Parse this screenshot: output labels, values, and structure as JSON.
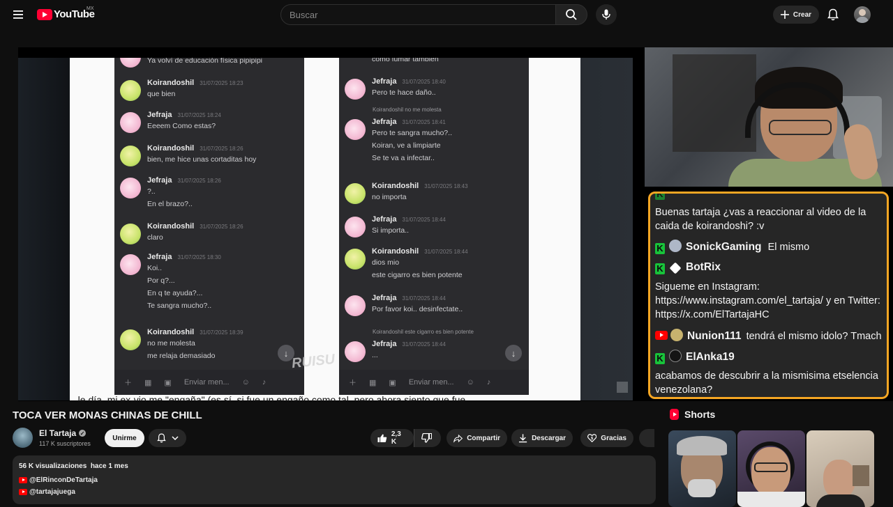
{
  "header": {
    "logo_text": "YouTube",
    "region": "MX",
    "search_placeholder": "Buscar",
    "create_label": "Crear"
  },
  "video": {
    "title": "TOCA VER MONAS CHINAS DE CHILL",
    "channel_name": "El Tartaja",
    "subscribers": "117 K suscriptores",
    "join_label": "Unirme",
    "like_count": "2,3 K",
    "share_label": "Compartir",
    "download_label": "Descargar",
    "thanks_label": "Gracias",
    "stats": "56 K visualizaciones  hace 1 mes",
    "links": [
      "@ElRinconDeTartaja",
      "@tartajajuega"
    ]
  },
  "screen": {
    "top_line_left": "Ya volví de educación física pipipipi",
    "top_line_right": "como fumar también",
    "input_placeholder": "Enviar men...",
    "watermark": "RUISU",
    "caption_fragment": "...le día, mi ex-vio me \"engaña\" (es sí, si fue un engaño como tal, pero ahora siento que fue...",
    "left_messages": [
      {
        "name": "Koirandoshil",
        "time": "31/07/2025 18:23",
        "lines": [
          "que bien"
        ],
        "avatar": "k"
      },
      {
        "name": "Jefraja",
        "time": "31/07/2025 18:24",
        "lines": [
          "Eeeem Como estas?"
        ],
        "avatar": "j"
      },
      {
        "name": "Koirandoshil",
        "time": "31/07/2025 18:26",
        "lines": [
          "bien, me hice unas cortaditas hoy"
        ],
        "avatar": "k"
      },
      {
        "name": "Jefraja",
        "time": "31/07/2025 18:26",
        "lines": [
          "?..",
          "En el brazo?.."
        ],
        "avatar": "j"
      },
      {
        "name": "Koirandoshil",
        "time": "31/07/2025 18:26",
        "lines": [
          "claro"
        ],
        "avatar": "k"
      },
      {
        "name": "Jefraja",
        "time": "31/07/2025 18:30",
        "lines": [
          "Koi..",
          "Por q?...",
          "En q te ayuda?...",
          "Te sangra mucho?.."
        ],
        "avatar": "j"
      },
      {
        "name": "Koirandoshil",
        "time": "31/07/2025 18:39",
        "lines": [
          "no me molesta",
          "me relaja demasiado"
        ],
        "avatar": "k"
      }
    ],
    "right_messages": [
      {
        "name": "Jefraja",
        "time": "31/07/2025 18:40",
        "lines": [
          "Pero te hace daño.."
        ],
        "avatar": "j"
      },
      {
        "name": "Jefraja",
        "time": "31/07/2025 18:41",
        "lines": [
          "Pero te sangra mucho?..",
          "Koiran, ve a limpiarte",
          "Se te va a infectar.."
        ],
        "avatar": "j",
        "reply": "Koirandoshil no me molesta"
      },
      {
        "name": "Koirandoshil",
        "time": "31/07/2025 18:43",
        "lines": [
          "no importa"
        ],
        "avatar": "k"
      },
      {
        "name": "Jefraja",
        "time": "31/07/2025 18:44",
        "lines": [
          "Si importa.."
        ],
        "avatar": "j"
      },
      {
        "name": "Koirandoshil",
        "time": "31/07/2025 18:44",
        "lines": [
          "dios mio",
          "este cigarro es bien potente"
        ],
        "avatar": "k"
      },
      {
        "name": "Jefraja",
        "time": "31/07/2025 18:44",
        "lines": [
          "Por favor koi.. desinfectate.."
        ],
        "avatar": "j"
      },
      {
        "name": "Jefraja",
        "time": "31/07/2025 18:44",
        "lines": [
          "..."
        ],
        "avatar": "j",
        "reply": "Koirandoshil este cigarro es bien potente"
      }
    ]
  },
  "chat": {
    "messages": [
      {
        "platform": "",
        "user": "",
        "text": "Buenas tartaja ¿vas a reaccionar al video de la caida de koirandoshi? :v"
      },
      {
        "platform": "kick",
        "user": "SonickGaming",
        "text": "El mismo"
      },
      {
        "platform": "kick",
        "user": "BotRix",
        "text": ""
      },
      {
        "platform": "",
        "user": "",
        "text": "Sigueme en Instagram: https://www.instagram.com/el_tartaja/ y en Twitter: https://x.com/ElTartajaHC"
      },
      {
        "platform": "youtube",
        "user": "Nunion111",
        "text": "tendrá el mismo idolo? Tmach"
      },
      {
        "platform": "kick",
        "user": "ElAnka19",
        "text": ""
      },
      {
        "platform": "",
        "user": "",
        "text": "acabamos de descubrir a la mismisima etselencia venezolana?"
      }
    ]
  },
  "sidebar": {
    "shorts_label": "Shorts"
  },
  "colors": {
    "accent_red": "#ff0033",
    "chat_border": "#f5a623",
    "kick_green": "#18c23a"
  }
}
